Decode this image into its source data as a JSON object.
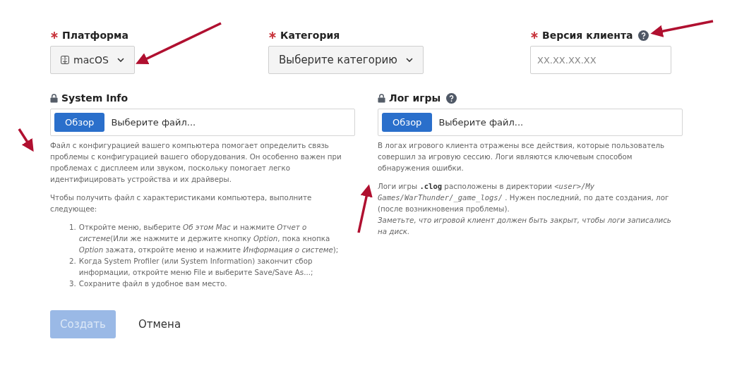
{
  "fields_top": [
    {
      "kind": "select",
      "label": "Платформа",
      "required": true,
      "value": "macOS",
      "has_icon": true
    },
    {
      "kind": "select",
      "label": "Категория",
      "required": true,
      "value": "Выберите категорию",
      "has_icon": false
    },
    {
      "kind": "input",
      "label": "Версия клиента",
      "required": true,
      "placeholder": "XX.XX.XX.XX",
      "help": true
    }
  ],
  "uploads": [
    {
      "label": "System Info",
      "help": false,
      "button": "Обзор",
      "placeholder": "Выберите файл...",
      "paragraphs": [
        [
          {
            "kind": "text",
            "text": "Файл с конфигурацией вашего компьютера помогает определить связь проблемы с конфигурацией вашего оборудования. Он особенно важен при проблемах с дисплеем или звуком, поскольку помогает легко идентифицировать устройства и их драйверы."
          }
        ],
        [
          {
            "kind": "text",
            "text": "Чтобы получить файл с характеристиками компьютера, выполните следующее:"
          }
        ]
      ],
      "steps": [
        {
          "number": "1.",
          "text": "Откройте меню, выберите *Об этом Mac* и нажмите *Отчет о системе*(Или же нажмите и держите кнопку *Option*, пока кнопка *Option* зажата, откройте меню и нажмите *Информация о системе*);"
        },
        {
          "number": "2.",
          "text": "Когда System Profiler (или System Information) закончит сбор информации, откройте меню File и выберите Save/Save As...;"
        },
        {
          "number": "3.",
          "text": "Сохраните файл в удобное вам место."
        }
      ]
    },
    {
      "label": "Лог игры",
      "help": true,
      "button": "Обзор",
      "placeholder": "Выберите файл...",
      "paragraphs": [
        [
          {
            "kind": "text",
            "text": "В логах игрового клиента отражены все действия, которые пользователь совершил за игровую сессию. Логи являются ключевым способом обнаружения ошибки."
          }
        ],
        [
          {
            "kind": "text",
            "text": "Логи игры "
          },
          {
            "kind": "code",
            "text": ".clog"
          },
          {
            "kind": "text",
            "text": " расположены в директории "
          },
          {
            "kind": "path",
            "text": "<user>/My Games/WarThunder/_game_logs/"
          },
          {
            "kind": "text",
            "text": " . Нужен последний, по дате создания, лог (после возникновения проблемы)."
          },
          {
            "kind": "note",
            "text": "Заметьте, что игровой клиент должен быть закрыт, чтобы логи записались на диск."
          }
        ]
      ]
    }
  ],
  "actions": {
    "submit": {
      "label": "Создать",
      "disabled": true
    },
    "cancel": {
      "label": "Отмена"
    }
  }
}
